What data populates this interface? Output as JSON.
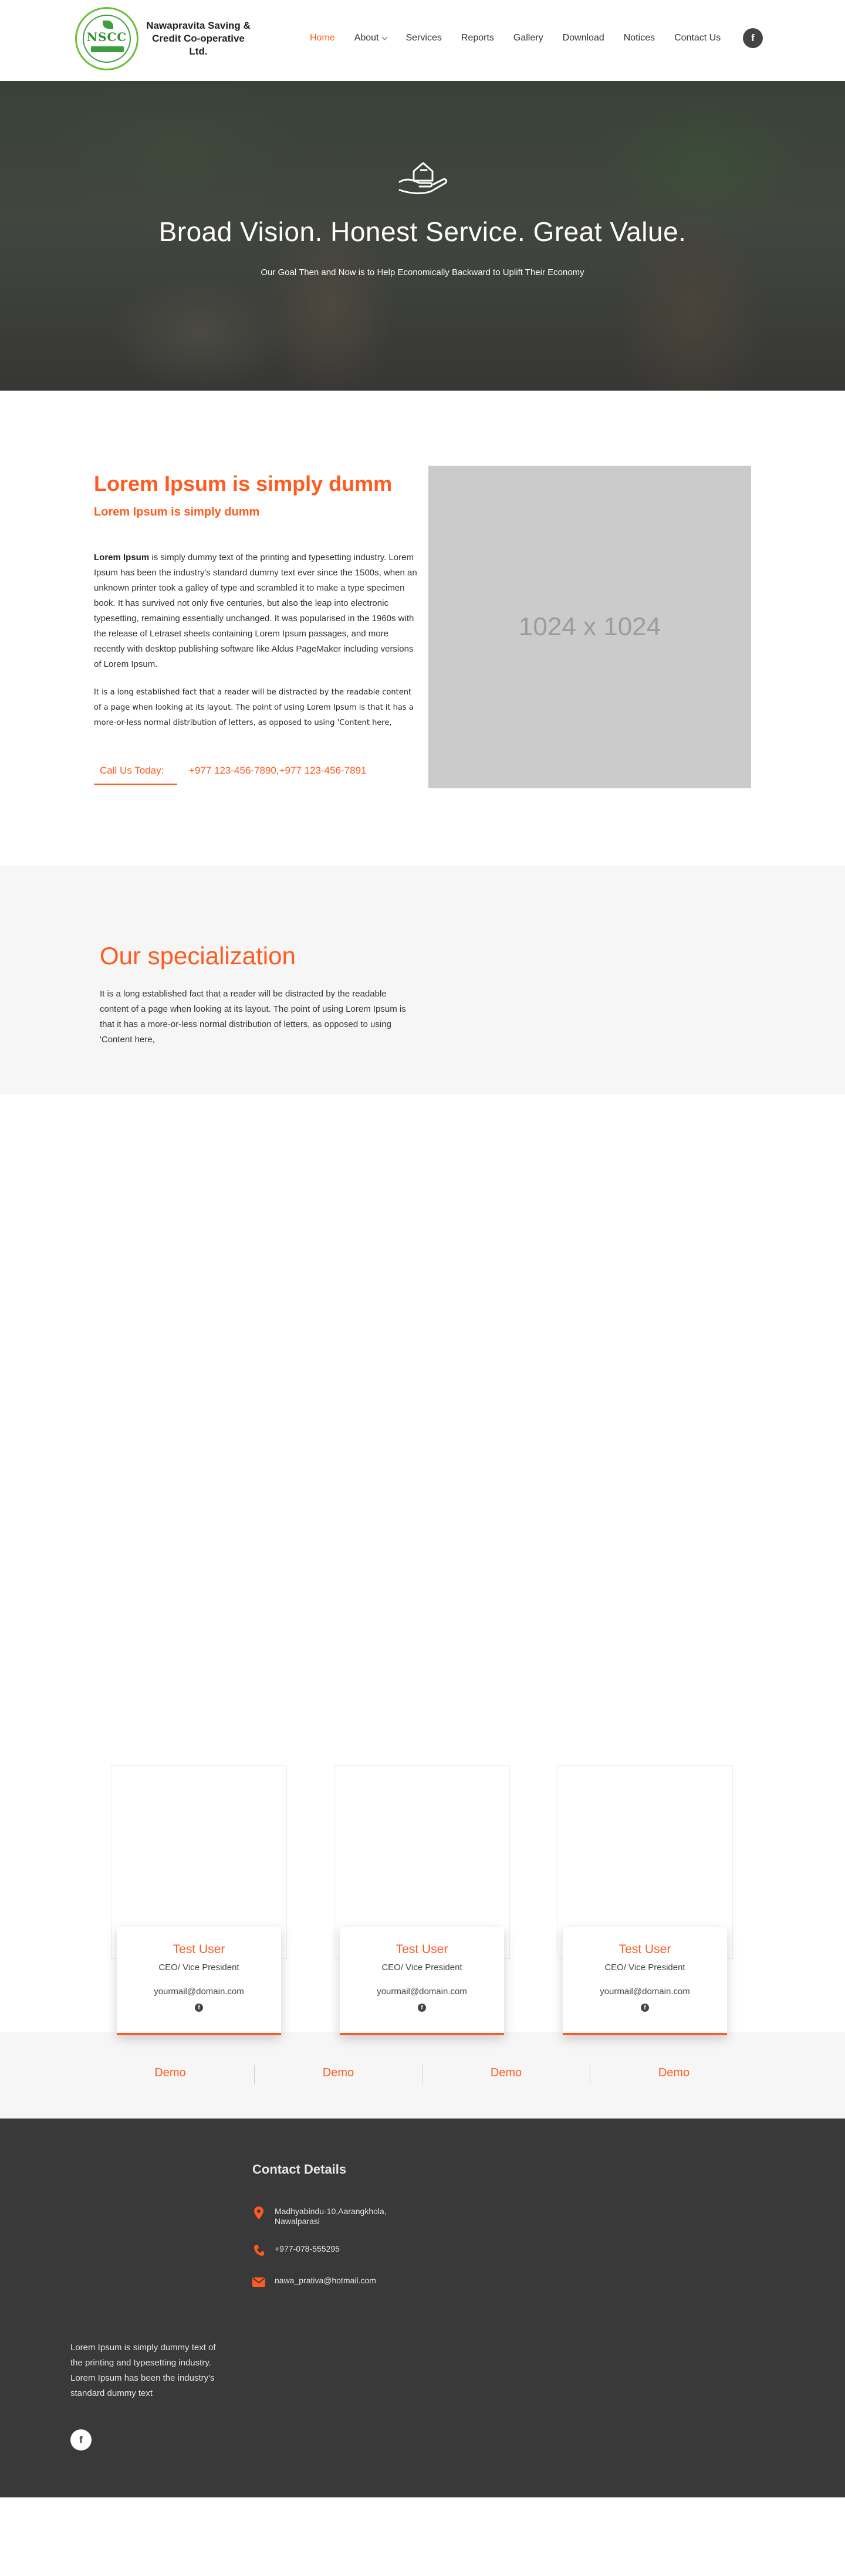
{
  "header": {
    "logo_text": "Nawapravita Saving & Credit Co-operative Ltd.",
    "logo_letters": "NSCC",
    "nav": [
      {
        "label": "Home",
        "active": true
      },
      {
        "label": "About",
        "has_dropdown": true
      },
      {
        "label": "Services"
      },
      {
        "label": "Reports"
      },
      {
        "label": "Gallery"
      },
      {
        "label": "Download"
      },
      {
        "label": "Notices"
      },
      {
        "label": "Contact Us"
      }
    ],
    "social_icon": "facebook-icon",
    "social_glyph": "f"
  },
  "hero": {
    "icon": "hand-holding-money-icon",
    "title": "Broad Vision. Honest Service. Great Value.",
    "subtitle": "Our Goal Then and Now is to Help Economically Backward to Uplift Their Economy"
  },
  "about": {
    "title": "Lorem Ipsum is simply dumm",
    "subtitle": "Lorem Ipsum is simply dumm",
    "p1_bold": "Lorem Ipsum",
    "p1_rest": " is simply dummy text of the printing and typesetting industry. Lorem Ipsum has been the industry's standard dummy text ever since the 1500s, when an unknown printer took a galley of type and scrambled it to make a type specimen book. It has survived not only five centuries, but also the leap into electronic typesetting, remaining essentially unchanged. It was popularised in the 1960s with the release of Letraset sheets containing Lorem Ipsum passages, and more recently with desktop publishing software like Aldus PageMaker including versions of Lorem Ipsum.",
    "p2": "It is a long established fact that a reader will be distracted by the readable content of a page when looking at its layout. The point of using Lorem Ipsum is that it has a more-or-less normal distribution of letters, as opposed to using 'Content here,",
    "call_label": "Call Us Today:",
    "call_numbers": "+977 123-456-7890,+977 123-456-7891",
    "image_placeholder": "1024 x 1024"
  },
  "specialization": {
    "title": "Our specialization",
    "text": "It is a long established fact that a reader will be distracted by the readable content of a page when looking at its layout. The point of using Lorem Ipsum is that it has a more-or-less normal distribution of letters, as opposed to using 'Content here,"
  },
  "team": [
    {
      "name": "Test User",
      "role": "CEO/ Vice President",
      "email": "yourmail@domain.com"
    },
    {
      "name": "Test User",
      "role": "CEO/ Vice President",
      "email": "yourmail@domain.com"
    },
    {
      "name": "Test User",
      "role": "CEO/ Vice President",
      "email": "yourmail@domain.com"
    }
  ],
  "demo": [
    "Demo",
    "Demo",
    "Demo",
    "Demo"
  ],
  "footer": {
    "contact_title": "Contact Details",
    "address": "Madhyabindu-10,Aarangkhola, Nawalparasi",
    "phone": "+977-078-555295",
    "email": "nawa_prativa@hotmail.com",
    "about": "Lorem Ipsum is simply dummy text of the printing and typesetting industry. Lorem Ipsum has been the industry's standard dummy text",
    "accent_color": "#ff5a1f"
  },
  "colors": {
    "accent": "#ff5a1f",
    "footer_bg": "#393939",
    "section_bg": "#f6f6f6"
  }
}
